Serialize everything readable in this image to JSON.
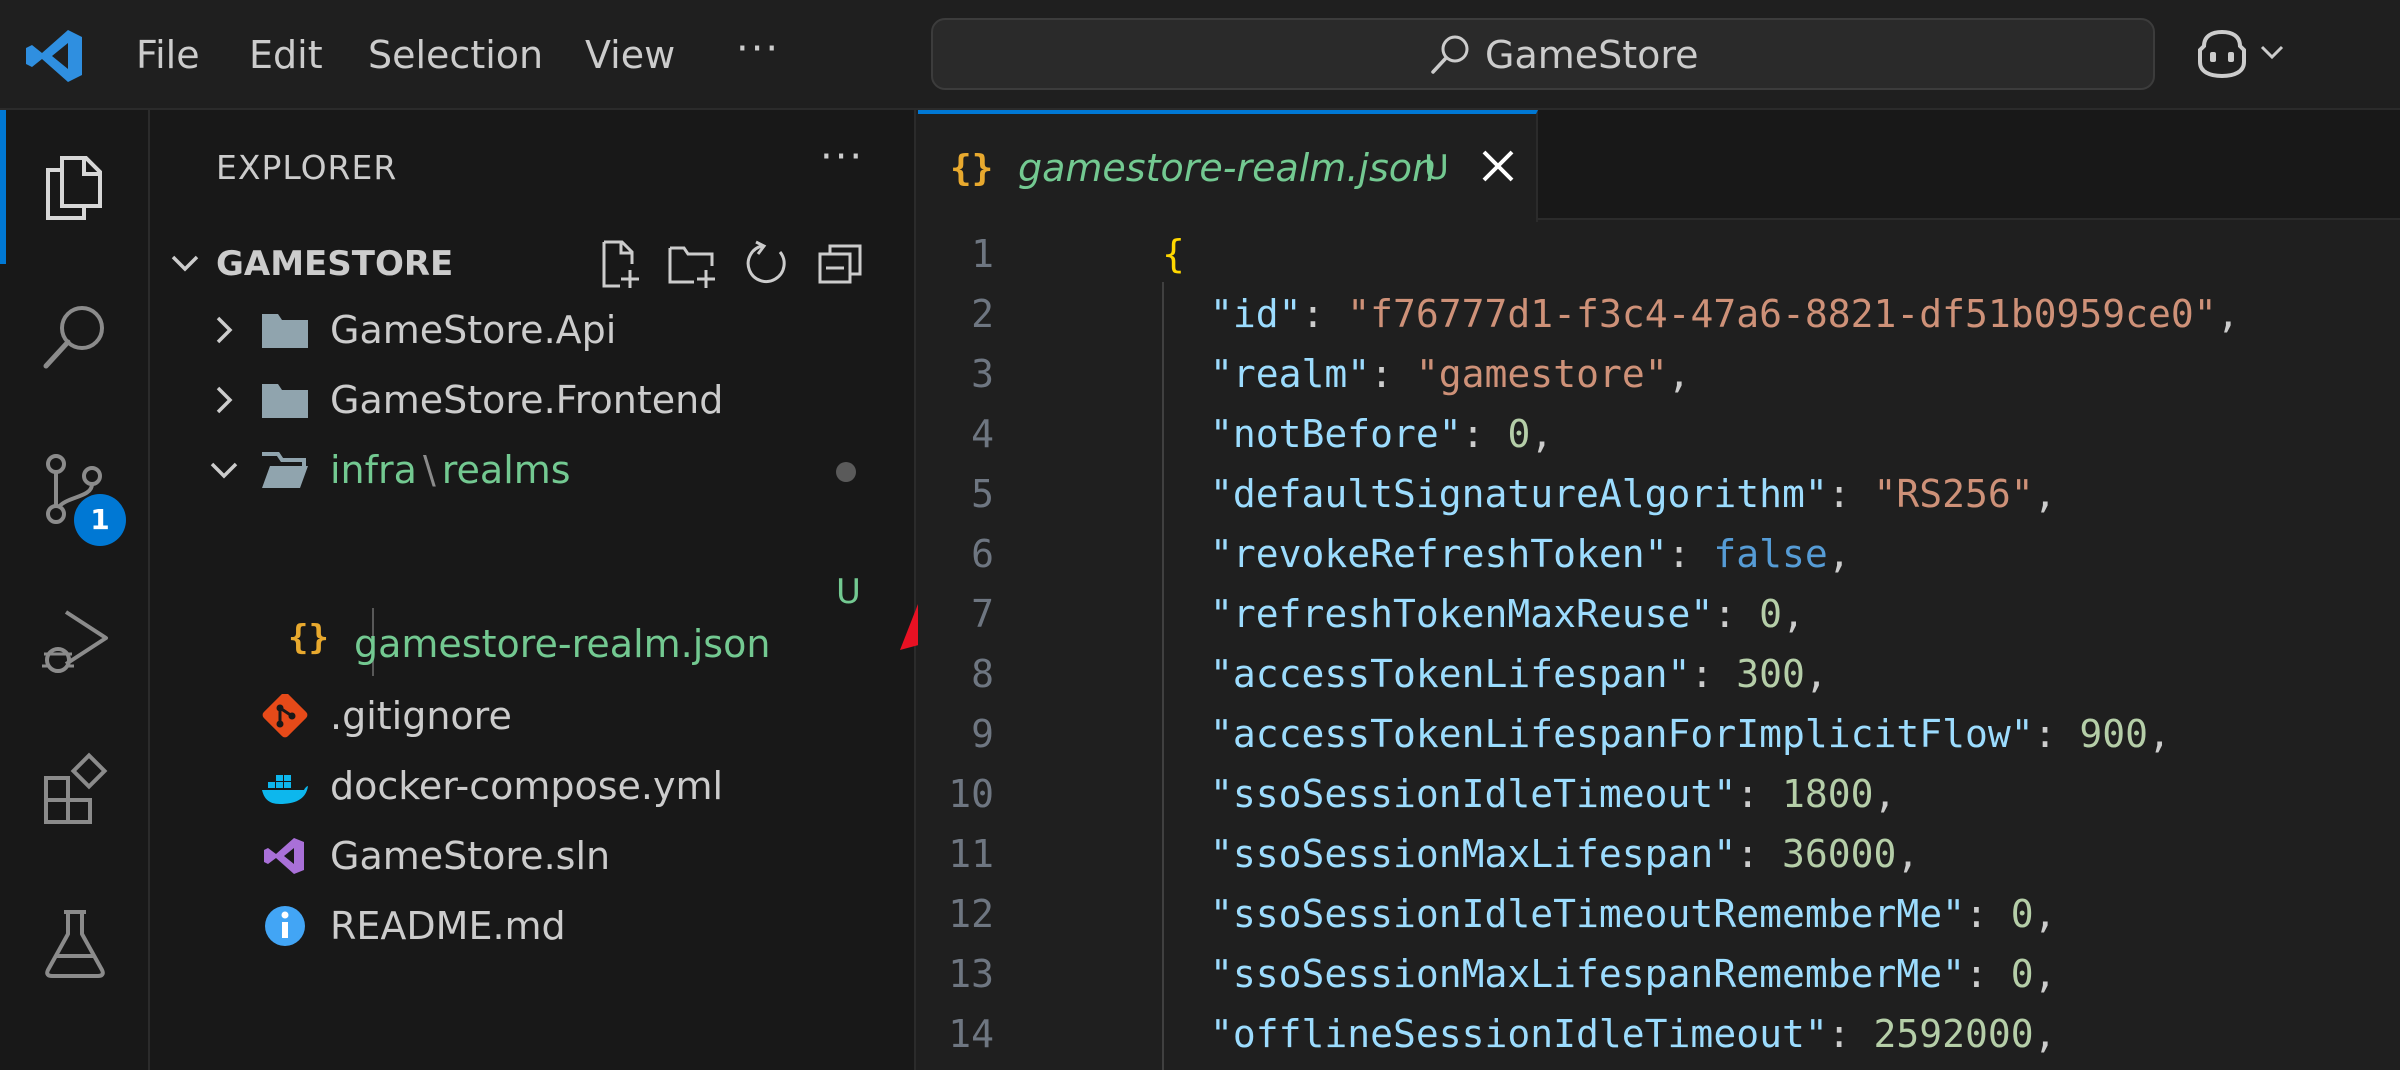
{
  "menu": {
    "file": "File",
    "edit": "Edit",
    "selection": "Selection",
    "view": "View",
    "more": "···"
  },
  "search": {
    "text": "GameStore"
  },
  "activity": {
    "source_control_badge": "1"
  },
  "explorer": {
    "title": "EXPLORER",
    "more": "···",
    "root": "GAMESTORE",
    "items": [
      {
        "label": "GameStore.Api",
        "kind": "folder"
      },
      {
        "label": "GameStore.Frontend",
        "kind": "folder"
      },
      {
        "label_a": "infra",
        "sep": "\\",
        "label_b": "realms",
        "kind": "folder-open"
      },
      {
        "label": "gamestore-realm.json",
        "kind": "json",
        "status": "U"
      },
      {
        "label": ".gitignore",
        "kind": "git"
      },
      {
        "label": "docker-compose.yml",
        "kind": "docker"
      },
      {
        "label": "GameStore.sln",
        "kind": "sln"
      },
      {
        "label": "README.md",
        "kind": "info"
      }
    ]
  },
  "editor": {
    "tab": {
      "icon": "{}",
      "label": "gamestore-realm.json",
      "status": "U"
    },
    "lines": [
      {
        "n": "1",
        "open": "{"
      },
      {
        "n": "2",
        "key": "\"id\"",
        "val": "\"f76777d1-f3c4-47a6-8821-df51b0959ce0\"",
        "vt": "str"
      },
      {
        "n": "3",
        "key": "\"realm\"",
        "val": "\"gamestore\"",
        "vt": "str"
      },
      {
        "n": "4",
        "key": "\"notBefore\"",
        "val": "0",
        "vt": "num"
      },
      {
        "n": "5",
        "key": "\"defaultSignatureAlgorithm\"",
        "val": "\"RS256\"",
        "vt": "str"
      },
      {
        "n": "6",
        "key": "\"revokeRefreshToken\"",
        "val": "false",
        "vt": "bool"
      },
      {
        "n": "7",
        "key": "\"refreshTokenMaxReuse\"",
        "val": "0",
        "vt": "num"
      },
      {
        "n": "8",
        "key": "\"accessTokenLifespan\"",
        "val": "300",
        "vt": "num"
      },
      {
        "n": "9",
        "key": "\"accessTokenLifespanForImplicitFlow\"",
        "val": "900",
        "vt": "num"
      },
      {
        "n": "10",
        "key": "\"ssoSessionIdleTimeout\"",
        "val": "1800",
        "vt": "num"
      },
      {
        "n": "11",
        "key": "\"ssoSessionMaxLifespan\"",
        "val": "36000",
        "vt": "num"
      },
      {
        "n": "12",
        "key": "\"ssoSessionIdleTimeoutRememberMe\"",
        "val": "0",
        "vt": "num"
      },
      {
        "n": "13",
        "key": "\"ssoSessionMaxLifespanRememberMe\"",
        "val": "0",
        "vt": "num"
      },
      {
        "n": "14",
        "key": "\"offlineSessionIdleTimeout\"",
        "val": "2592000",
        "vt": "num"
      }
    ]
  },
  "colors": {
    "accent": "#0078d4",
    "untracked": "#73c991",
    "annotation": "#e81123"
  }
}
